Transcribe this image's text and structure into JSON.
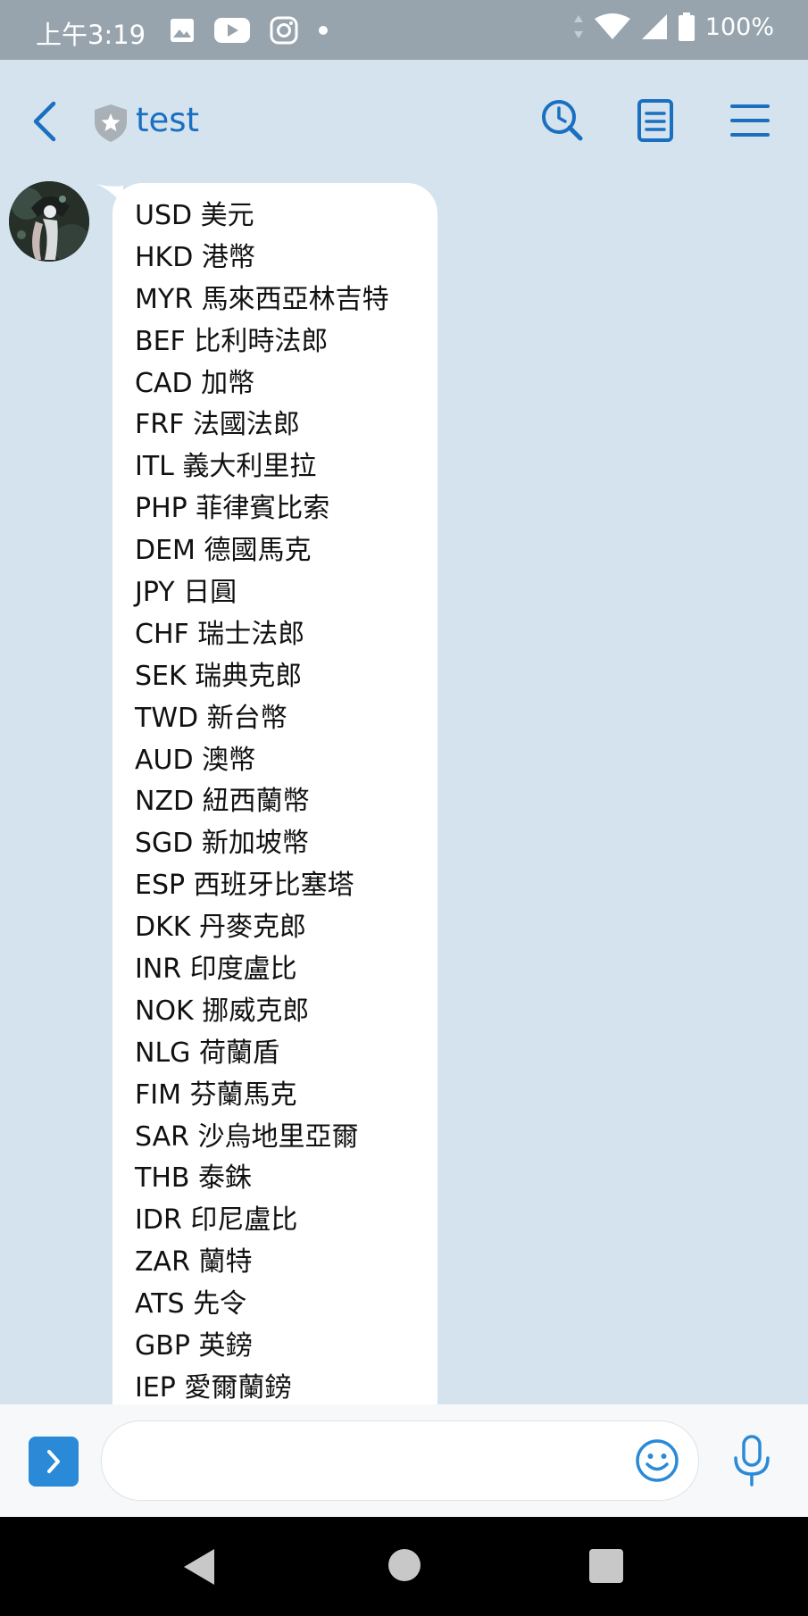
{
  "status_bar": {
    "time": "上午3:19",
    "battery": "100%",
    "icons": [
      "gallery-icon",
      "youtube-icon",
      "instagram-icon",
      "dot-icon",
      "data-arrows-icon",
      "wifi-icon",
      "signal-icon",
      "battery-icon"
    ]
  },
  "header": {
    "title": "test",
    "icons": [
      "back-chevron-icon",
      "shield-star-icon",
      "search-icon",
      "notes-icon",
      "menu-icon"
    ]
  },
  "message": {
    "lines": [
      "USD 美元",
      "HKD 港幣",
      "MYR 馬來西亞林吉特",
      "BEF 比利時法郎",
      "CAD 加幣",
      "FRF 法國法郎",
      "ITL 義大利里拉",
      "PHP 菲律賓比索",
      "DEM 德國馬克",
      "JPY 日圓",
      "CHF 瑞士法郎",
      "SEK 瑞典克郎",
      "TWD 新台幣",
      "AUD 澳幣",
      "NZD 紐西蘭幣",
      "SGD 新加坡幣",
      "ESP 西班牙比塞塔",
      "DKK 丹麥克郎",
      "INR 印度盧比",
      "NOK 挪威克郎",
      "NLG 荷蘭盾",
      "FIM 芬蘭馬克",
      "SAR 沙烏地里亞爾",
      "THB 泰銖",
      "IDR 印尼盧比",
      "ZAR 蘭特",
      "ATS 先令",
      "GBP 英鎊",
      "IEP 愛爾蘭鎊"
    ]
  },
  "input_bar": {
    "placeholder": "",
    "icons": [
      "expand-chevron-icon",
      "emoji-icon",
      "microphone-icon"
    ]
  },
  "colors": {
    "accent": "#1a6fc0",
    "background": "#d4e3ee",
    "status_bar": "#98a4ad",
    "expand_button": "#2a8ad8"
  }
}
